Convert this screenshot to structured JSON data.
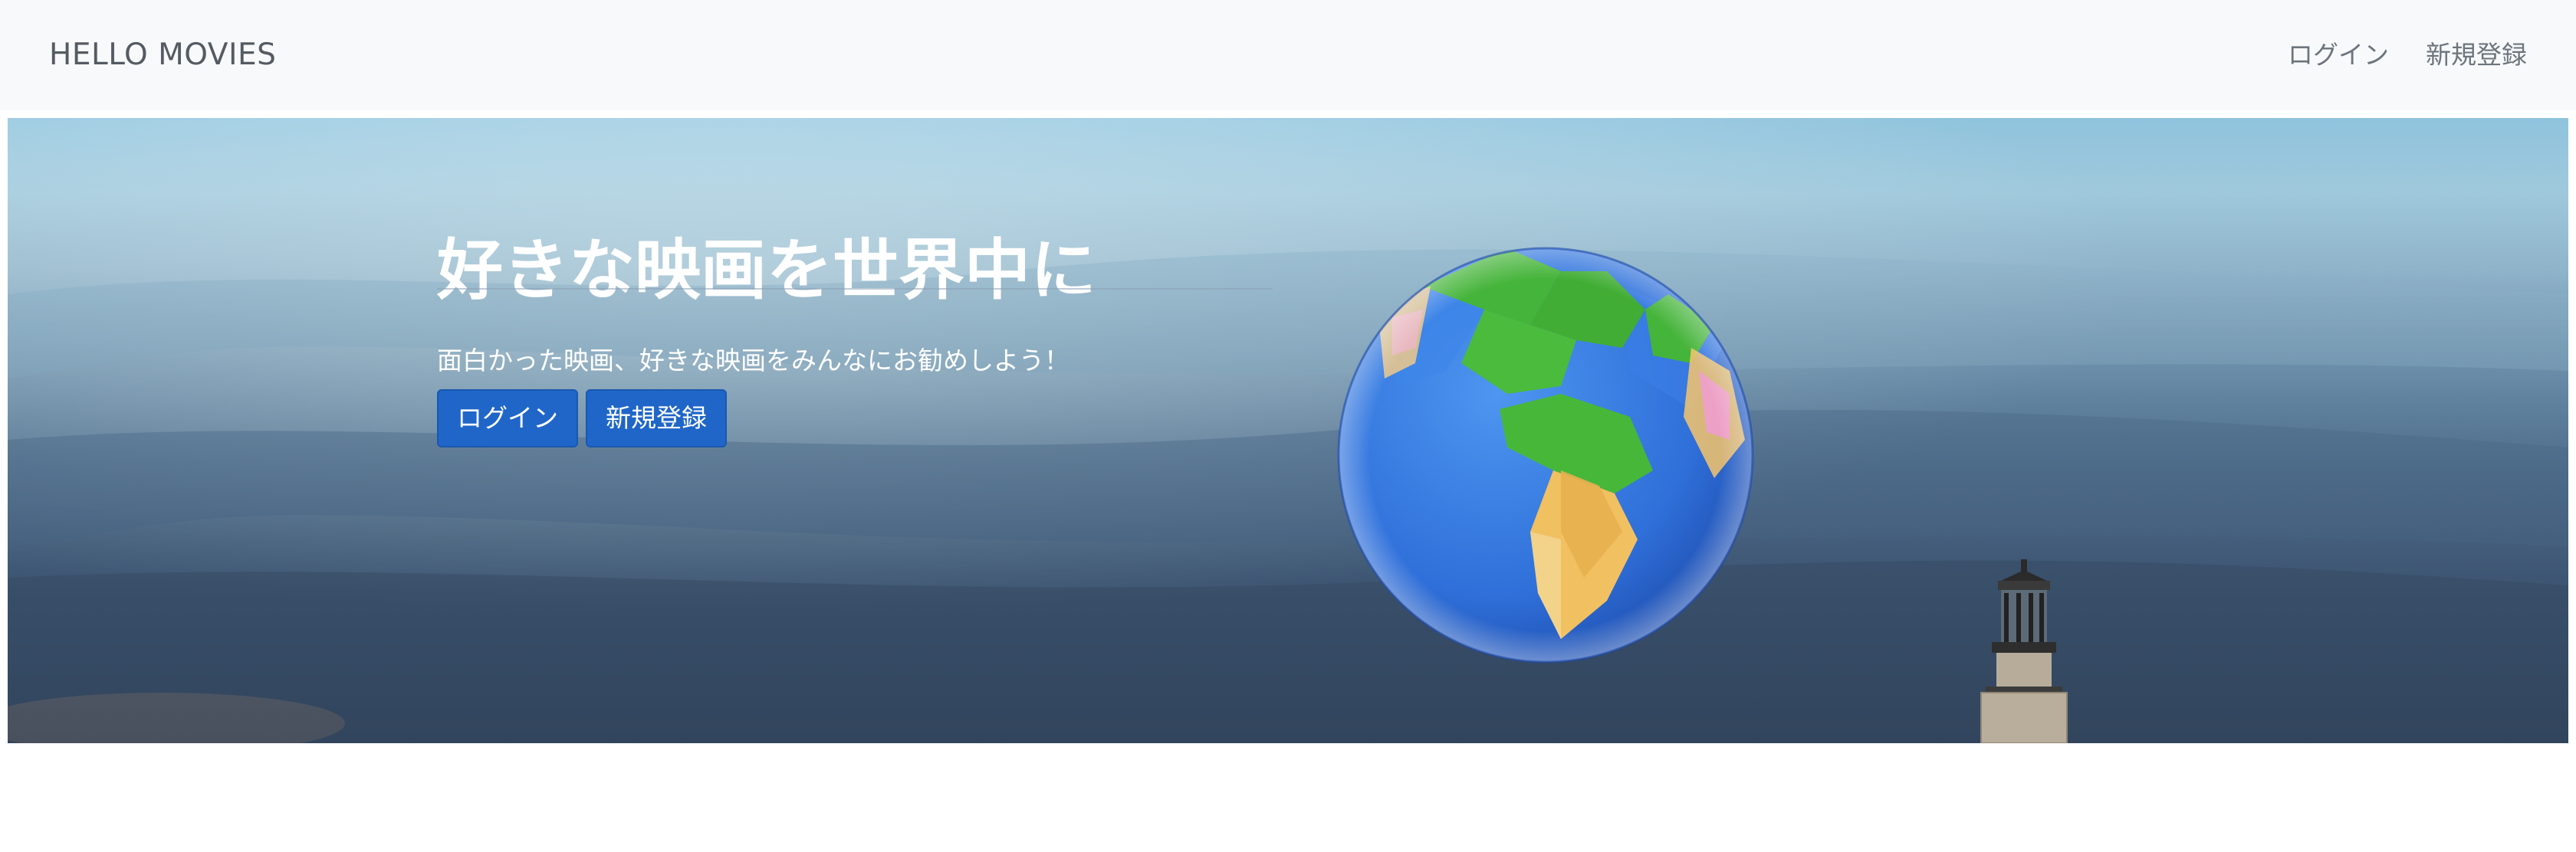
{
  "navbar": {
    "brand": "HELLO MOVIES",
    "links": [
      {
        "label": "ログイン"
      },
      {
        "label": "新規登録"
      }
    ]
  },
  "hero": {
    "title": "好きな映画を世界中に",
    "lead": "面白かった映画、好きな映画をみんなにお勧めしよう！",
    "buttons": [
      {
        "label": "ログイン"
      },
      {
        "label": "新規登録"
      }
    ],
    "background": "sky-with-lighthouse-image",
    "illustration": "globe-icon",
    "colors": {
      "button": "#1f66c8",
      "navbar_bg": "#f8f9fa",
      "title_text": "#ffffff"
    }
  }
}
